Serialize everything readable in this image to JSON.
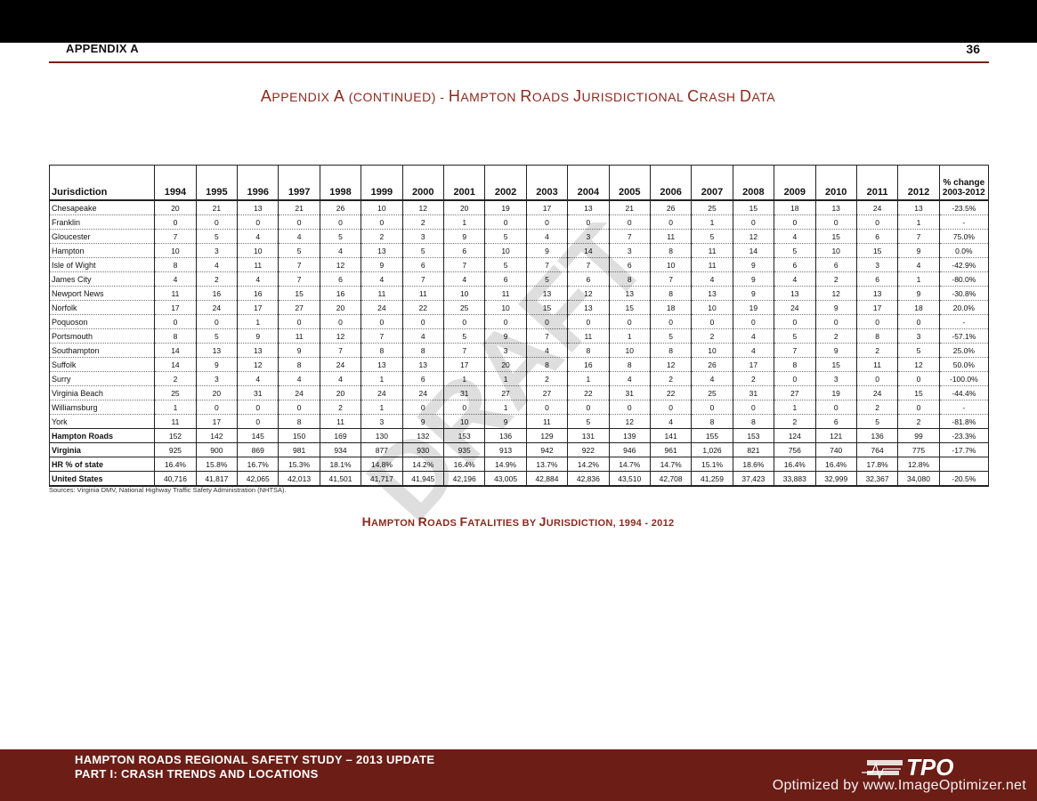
{
  "header": {
    "section": "APPENDIX A",
    "page_number": "36"
  },
  "title": "Appendix A (continued) - Hampton Roads Jurisdictional Crash Data",
  "table": {
    "columns": [
      "Jurisdiction",
      "1994",
      "1995",
      "1996",
      "1997",
      "1998",
      "1999",
      "2000",
      "2001",
      "2002",
      "2003",
      "2004",
      "2005",
      "2006",
      "2007",
      "2008",
      "2009",
      "2010",
      "2011",
      "2012"
    ],
    "change_header": [
      "% change",
      "2003-2012"
    ],
    "rows": [
      {
        "name": "Chesapeake",
        "values": [
          "20",
          "21",
          "13",
          "21",
          "26",
          "10",
          "12",
          "20",
          "19",
          "17",
          "13",
          "21",
          "26",
          "25",
          "15",
          "18",
          "13",
          "24",
          "13"
        ],
        "change": "-23.5%"
      },
      {
        "name": "Franklin",
        "values": [
          "0",
          "0",
          "0",
          "0",
          "0",
          "0",
          "2",
          "1",
          "0",
          "0",
          "0",
          "0",
          "0",
          "1",
          "0",
          "0",
          "0",
          "0",
          "1"
        ],
        "change": "-"
      },
      {
        "name": "Gloucester",
        "values": [
          "7",
          "5",
          "4",
          "4",
          "5",
          "2",
          "3",
          "9",
          "5",
          "4",
          "3",
          "7",
          "11",
          "5",
          "12",
          "4",
          "15",
          "6",
          "7"
        ],
        "change": "75.0%"
      },
      {
        "name": "Hampton",
        "values": [
          "10",
          "3",
          "10",
          "5",
          "4",
          "13",
          "5",
          "6",
          "10",
          "9",
          "14",
          "3",
          "8",
          "11",
          "14",
          "5",
          "10",
          "15",
          "9"
        ],
        "change": "0.0%"
      },
      {
        "name": "Isle of Wight",
        "values": [
          "8",
          "4",
          "11",
          "7",
          "12",
          "9",
          "6",
          "7",
          "5",
          "7",
          "7",
          "6",
          "10",
          "11",
          "9",
          "6",
          "6",
          "3",
          "4"
        ],
        "change": "-42.9%"
      },
      {
        "name": "James City",
        "values": [
          "4",
          "2",
          "4",
          "7",
          "6",
          "4",
          "7",
          "4",
          "6",
          "5",
          "6",
          "8",
          "7",
          "4",
          "9",
          "4",
          "2",
          "6",
          "1"
        ],
        "change": "-80.0%"
      },
      {
        "name": "Newport News",
        "values": [
          "11",
          "16",
          "16",
          "15",
          "16",
          "11",
          "11",
          "10",
          "11",
          "13",
          "12",
          "13",
          "8",
          "13",
          "9",
          "13",
          "12",
          "13",
          "9"
        ],
        "change": "-30.8%"
      },
      {
        "name": "Norfolk",
        "values": [
          "17",
          "24",
          "17",
          "27",
          "20",
          "24",
          "22",
          "25",
          "10",
          "15",
          "13",
          "15",
          "18",
          "10",
          "19",
          "24",
          "9",
          "17",
          "18"
        ],
        "change": "20.0%"
      },
      {
        "name": "Poquoson",
        "values": [
          "0",
          "0",
          "1",
          "0",
          "0",
          "0",
          "0",
          "0",
          "0",
          "0",
          "0",
          "0",
          "0",
          "0",
          "0",
          "0",
          "0",
          "0",
          "0"
        ],
        "change": "-"
      },
      {
        "name": "Portsmouth",
        "values": [
          "8",
          "5",
          "9",
          "11",
          "12",
          "7",
          "4",
          "5",
          "9",
          "7",
          "11",
          "1",
          "5",
          "2",
          "4",
          "5",
          "2",
          "8",
          "3"
        ],
        "change": "-57.1%"
      },
      {
        "name": "Southampton",
        "values": [
          "14",
          "13",
          "13",
          "9",
          "7",
          "8",
          "8",
          "7",
          "3",
          "4",
          "8",
          "10",
          "8",
          "10",
          "4",
          "7",
          "9",
          "2",
          "5"
        ],
        "change": "25.0%"
      },
      {
        "name": "Suffolk",
        "values": [
          "14",
          "9",
          "12",
          "8",
          "24",
          "13",
          "13",
          "17",
          "20",
          "8",
          "16",
          "8",
          "12",
          "26",
          "17",
          "8",
          "15",
          "11",
          "12"
        ],
        "change": "50.0%"
      },
      {
        "name": "Surry",
        "values": [
          "2",
          "3",
          "4",
          "4",
          "4",
          "1",
          "6",
          "1",
          "1",
          "2",
          "1",
          "4",
          "2",
          "4",
          "2",
          "0",
          "3",
          "0",
          "0"
        ],
        "change": "-100.0%"
      },
      {
        "name": "Virginia Beach",
        "values": [
          "25",
          "20",
          "31",
          "24",
          "20",
          "24",
          "24",
          "31",
          "27",
          "27",
          "22",
          "31",
          "22",
          "25",
          "31",
          "27",
          "19",
          "24",
          "15"
        ],
        "change": "-44.4%"
      },
      {
        "name": "Williamsburg",
        "values": [
          "1",
          "0",
          "0",
          "0",
          "2",
          "1",
          "0",
          "0",
          "1",
          "0",
          "0",
          "0",
          "0",
          "0",
          "0",
          "1",
          "0",
          "2",
          "0"
        ],
        "change": "-"
      },
      {
        "name": "York",
        "values": [
          "11",
          "17",
          "0",
          "8",
          "11",
          "3",
          "9",
          "10",
          "9",
          "11",
          "5",
          "12",
          "4",
          "8",
          "8",
          "2",
          "6",
          "5",
          "2"
        ],
        "change": "-81.8%"
      }
    ],
    "summary_rows": [
      {
        "name": "Hampton Roads",
        "values": [
          "152",
          "142",
          "145",
          "150",
          "169",
          "130",
          "132",
          "153",
          "136",
          "129",
          "131",
          "139",
          "141",
          "155",
          "153",
          "124",
          "121",
          "136",
          "99"
        ],
        "change": "-23.3%"
      },
      {
        "name": "Virginia",
        "values": [
          "925",
          "900",
          "869",
          "981",
          "934",
          "877",
          "930",
          "935",
          "913",
          "942",
          "922",
          "946",
          "961",
          "1,026",
          "821",
          "756",
          "740",
          "764",
          "775"
        ],
        "change": "-17.7%"
      },
      {
        "name": "HR % of state",
        "values": [
          "16.4%",
          "15.8%",
          "16.7%",
          "15.3%",
          "18.1%",
          "14.8%",
          "14.2%",
          "16.4%",
          "14.9%",
          "13.7%",
          "14.2%",
          "14.7%",
          "14.7%",
          "15.1%",
          "18.6%",
          "16.4%",
          "16.4%",
          "17.8%",
          "12.8%"
        ],
        "change": ""
      },
      {
        "name": "United States",
        "values": [
          "40,716",
          "41,817",
          "42,065",
          "42,013",
          "41,501",
          "41,717",
          "41,945",
          "42,196",
          "43,005",
          "42,884",
          "42,836",
          "43,510",
          "42,708",
          "41,259",
          "37,423",
          "33,883",
          "32,999",
          "32,367",
          "34,080"
        ],
        "change": "-20.5%"
      }
    ]
  },
  "sources": "Sources: Virginia DMV, National Highway Traffic Safety Administration (NHTSA).",
  "chart_title": "Hampton Roads Fatalities by Jurisdiction, 1994 - 2012",
  "watermark": "DRAFT",
  "footer": {
    "line1": "HAMPTON ROADS REGIONAL SAFETY STUDY – 2013 UPDATE",
    "line2": "PART I: CRASH TRENDS AND LOCATIONS",
    "logo_text": "TPO",
    "optimized": "Optimized by www.ImageOptimizer.net"
  },
  "colors": {
    "accent": "#8b2a1e",
    "footer_bg": "#6b1d16"
  }
}
